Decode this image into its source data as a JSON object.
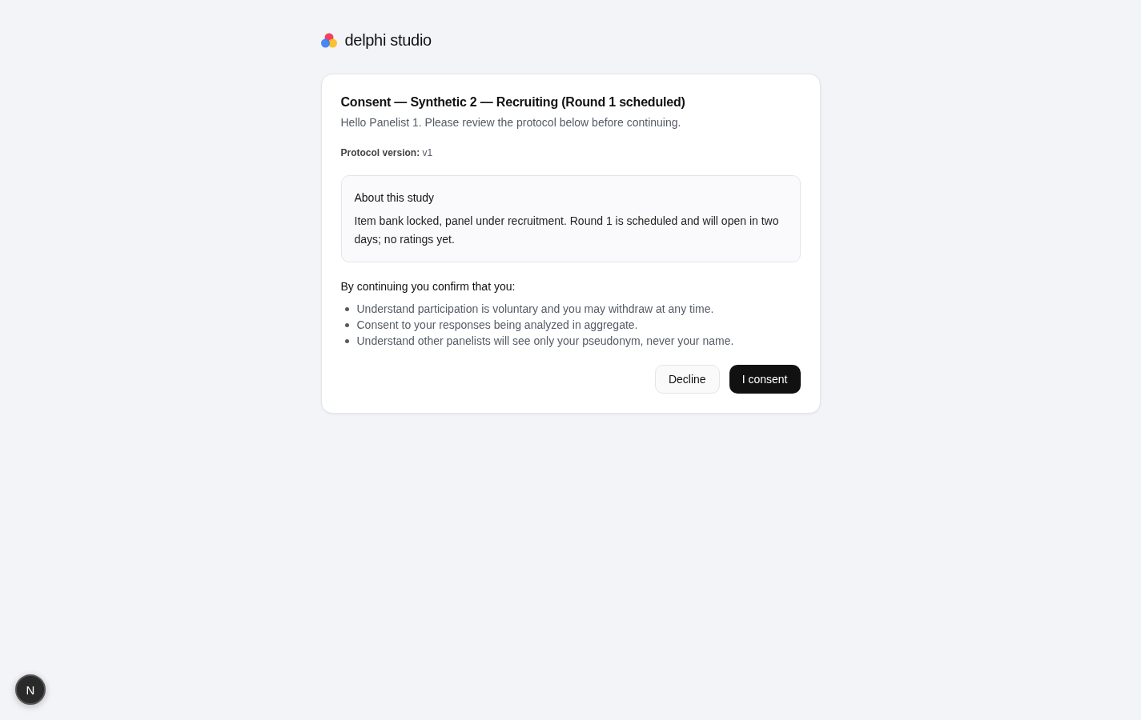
{
  "header": {
    "brand": "delphi studio"
  },
  "consent": {
    "title": "Consent — Synthetic 2 — Recruiting (Round 1 scheduled)",
    "greeting": "Hello Panelist 1. Please review the protocol below before continuing.",
    "protocol_version": "**Protocol version:** v1",
    "about": {
      "heading": "About this study",
      "text": "Item bank locked, panel under recruitment. Round 1 is scheduled and will open in two days; no ratings yet."
    },
    "confirm_intro": "By continuing you confirm that you:",
    "confirmations": [
      "Understand participation is voluntary and you may withdraw at any time.",
      "Consent to your responses being analyzed in aggregate.",
      "Understand other panelists will see only your pseudonym, never your name."
    ],
    "buttons": [
      {
        "label": "Decline",
        "kind": "secondary"
      },
      {
        "label": "I consent",
        "kind": "primary"
      }
    ]
  },
  "dev_badge": {
    "label": "N"
  }
}
